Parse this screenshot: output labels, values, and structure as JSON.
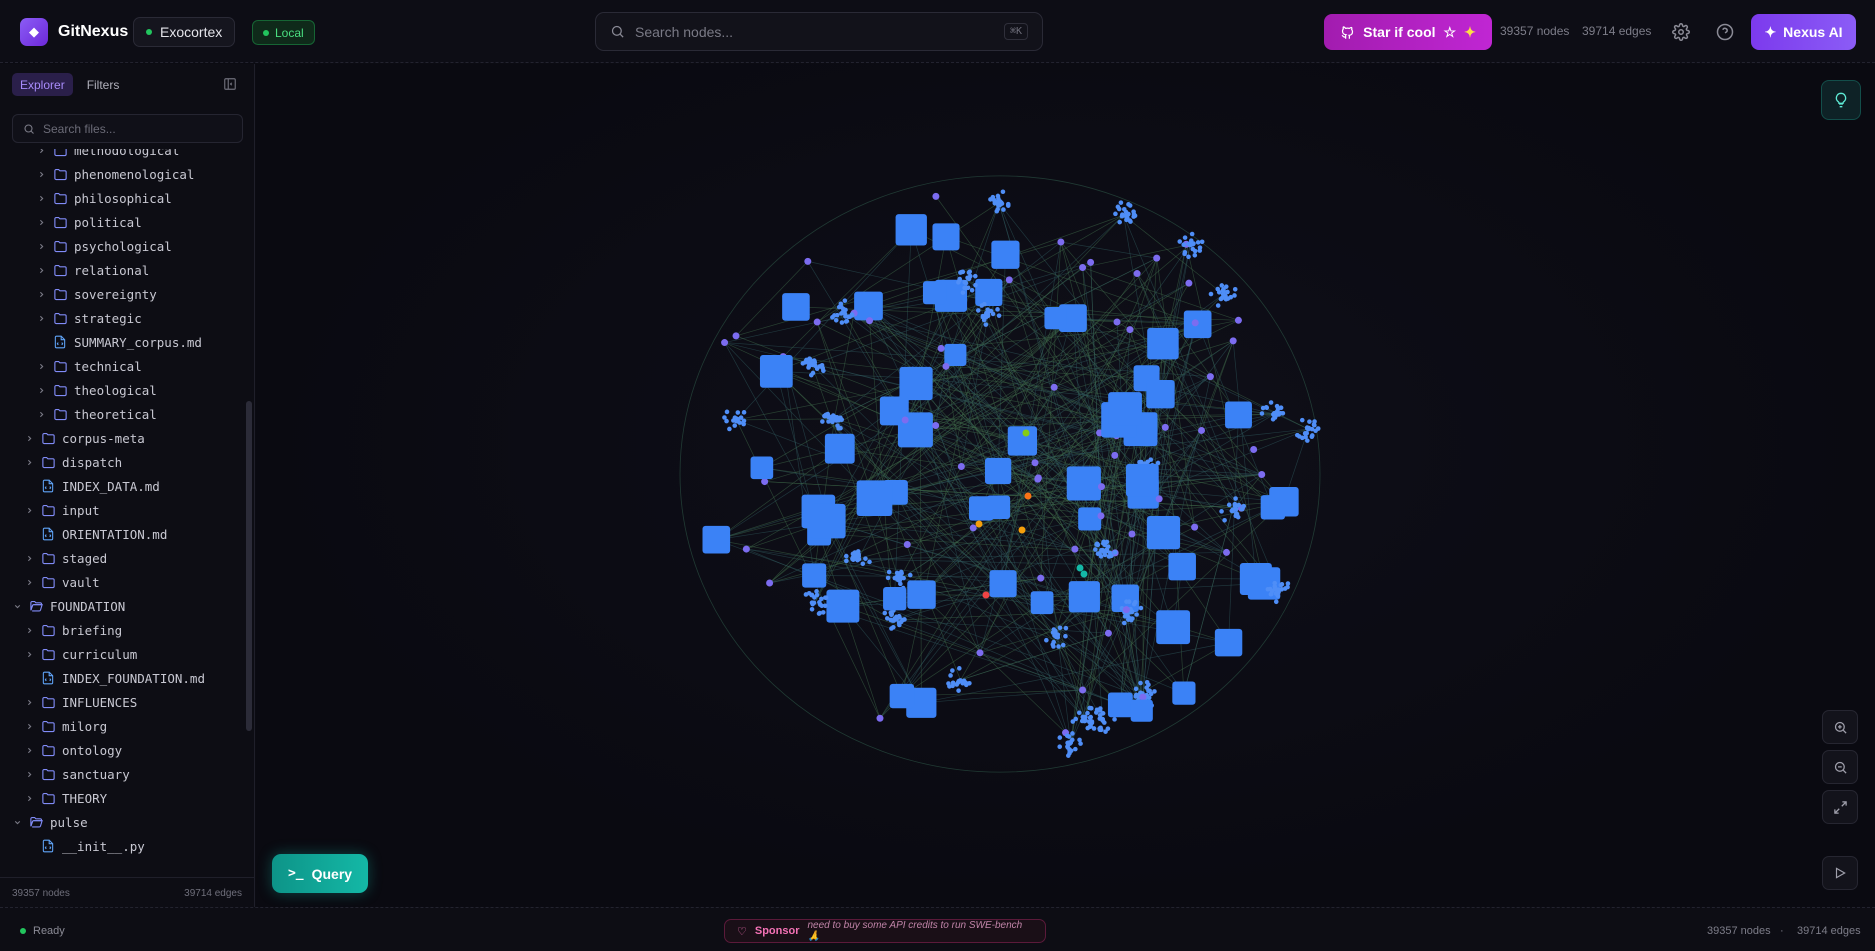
{
  "app": {
    "name": "GitNexus",
    "repo": "Exocortex",
    "mode": "Local"
  },
  "search": {
    "placeholder": "Search nodes...",
    "shortcut": "⌘K"
  },
  "header": {
    "star_label": "Star if cool",
    "nodes_count": "39357 nodes",
    "edges_count": "39714 edges",
    "nexus_label": "Nexus AI"
  },
  "sidebar": {
    "tabs": [
      "Explorer",
      "Filters"
    ],
    "search_placeholder": "Search files...",
    "tree": [
      {
        "label": "methodological",
        "type": "folder",
        "depth": 2,
        "open": false
      },
      {
        "label": "phenomenological",
        "type": "folder",
        "depth": 2,
        "open": false
      },
      {
        "label": "philosophical",
        "type": "folder",
        "depth": 2,
        "open": false
      },
      {
        "label": "political",
        "type": "folder",
        "depth": 2,
        "open": false
      },
      {
        "label": "psychological",
        "type": "folder",
        "depth": 2,
        "open": false
      },
      {
        "label": "relational",
        "type": "folder",
        "depth": 2,
        "open": false
      },
      {
        "label": "sovereignty",
        "type": "folder",
        "depth": 2,
        "open": false
      },
      {
        "label": "strategic",
        "type": "folder",
        "depth": 2,
        "open": false
      },
      {
        "label": "SUMMARY_corpus.md",
        "type": "file",
        "depth": 2
      },
      {
        "label": "technical",
        "type": "folder",
        "depth": 2,
        "open": false
      },
      {
        "label": "theological",
        "type": "folder",
        "depth": 2,
        "open": false
      },
      {
        "label": "theoretical",
        "type": "folder",
        "depth": 2,
        "open": false
      },
      {
        "label": "corpus-meta",
        "type": "folder",
        "depth": 1,
        "open": false
      },
      {
        "label": "dispatch",
        "type": "folder",
        "depth": 1,
        "open": false
      },
      {
        "label": "INDEX_DATA.md",
        "type": "file",
        "depth": 1
      },
      {
        "label": "input",
        "type": "folder",
        "depth": 1,
        "open": false
      },
      {
        "label": "ORIENTATION.md",
        "type": "file",
        "depth": 1
      },
      {
        "label": "staged",
        "type": "folder",
        "depth": 1,
        "open": false
      },
      {
        "label": "vault",
        "type": "folder",
        "depth": 1,
        "open": false
      },
      {
        "label": "FOUNDATION",
        "type": "folder",
        "depth": 0,
        "open": true
      },
      {
        "label": "briefing",
        "type": "folder",
        "depth": 1,
        "open": false
      },
      {
        "label": "curriculum",
        "type": "folder",
        "depth": 1,
        "open": false
      },
      {
        "label": "INDEX_FOUNDATION.md",
        "type": "file",
        "depth": 1
      },
      {
        "label": "INFLUENCES",
        "type": "folder",
        "depth": 1,
        "open": false
      },
      {
        "label": "milorg",
        "type": "folder",
        "depth": 1,
        "open": false
      },
      {
        "label": "ontology",
        "type": "folder",
        "depth": 1,
        "open": false
      },
      {
        "label": "sanctuary",
        "type": "folder",
        "depth": 1,
        "open": false
      },
      {
        "label": "THEORY",
        "type": "folder",
        "depth": 1,
        "open": false
      },
      {
        "label": "pulse",
        "type": "folder",
        "depth": 0,
        "open": true
      },
      {
        "label": "__init__.py",
        "type": "file",
        "depth": 1
      }
    ],
    "footer_nodes": "39357 nodes",
    "footer_edges": "39714 edges"
  },
  "canvas": {
    "query_label": "Query"
  },
  "status": {
    "state": "Ready",
    "sponsor_label": "Sponsor",
    "sponsor_message": "need to buy some API credits to run SWE-bench 🙏",
    "nodes_count": "39357 nodes",
    "separator": "·",
    "edges_count": "39714 edges"
  },
  "colors": {
    "accent": "#8b5cf6",
    "star": "#c026d3",
    "query": "#14b8a6",
    "node_cluster": "#3b82f6",
    "edge": "#3f6b4a",
    "ready": "#22c55e"
  }
}
